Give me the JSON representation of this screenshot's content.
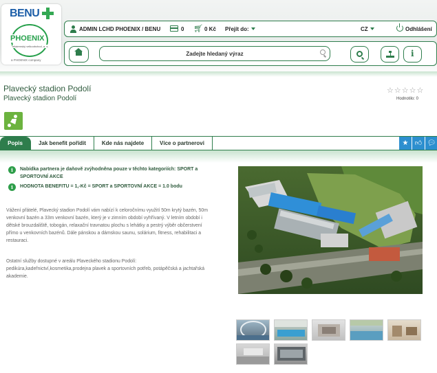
{
  "brand": {
    "benu": "BENU",
    "phoenix": "PHOENIX",
    "phoenix_sub": "lékárenský velkoobchod, a. s.",
    "company": "a PHOENIX company"
  },
  "topbar": {
    "user_name": "ADMIN LCHD PHOENIX / BENU",
    "points_value": "0",
    "cart_value": "0 Kč",
    "jump_label": "Přejít do:",
    "language": "CZ",
    "logout_label": "Odhlášení"
  },
  "search": {
    "placeholder": "Zadejte hledaný výraz"
  },
  "partner": {
    "title": "Plavecký stadion Podolí",
    "subtitle": "Plavecký stadion Podolí",
    "stars": "☆☆☆☆☆",
    "rating_label": "Hodnotilo: 0"
  },
  "tabs": [
    {
      "label": "Popis",
      "active": true
    },
    {
      "label": "Jak benefit pořídit",
      "active": false
    },
    {
      "label": "Kde nás najdete",
      "active": false
    },
    {
      "label": "Více o partnerovi",
      "active": false
    }
  ],
  "notes": [
    "Nabídka partnera je daňově zvýhodněna pouze v těchto kategoriích: SPORT a SPORTOVNÍ AKCE",
    "HODNOTA BENEFITU = 1,-Kč = SPORT a SPORTOVNÍ AKCE = 1.0 bodu"
  ],
  "description": [
    "Vážení přátelé, Plavecký stadion Podolí vám nabízí k celoročnímu využití 50m krytý bazén, 50m venkovní bazén a 33m venkovní bazén, který je v zimním období vyhřívaný. V letním období i dětské brouzdaliště, tobogán, relaxační travnatou plochu s lehátky a pestrý výběr občerstvení přímo u venkovních bazénů.  Dále pánskou a dámskou saunu, solárium, fitness, rehabilitaci a restauraci.",
    "Ostatní služby dostupné v areálu Plaveckého stadionu Podolí: pedikúra,kadeřnictví,kosmetika,prodejna plavek a sportovních potřeb, potápěčská a jachtařská akademie."
  ],
  "colors": {
    "brand_green": "#2e7d4c",
    "accent_blue": "#2d8fcf",
    "category_green": "#6cb33f"
  }
}
